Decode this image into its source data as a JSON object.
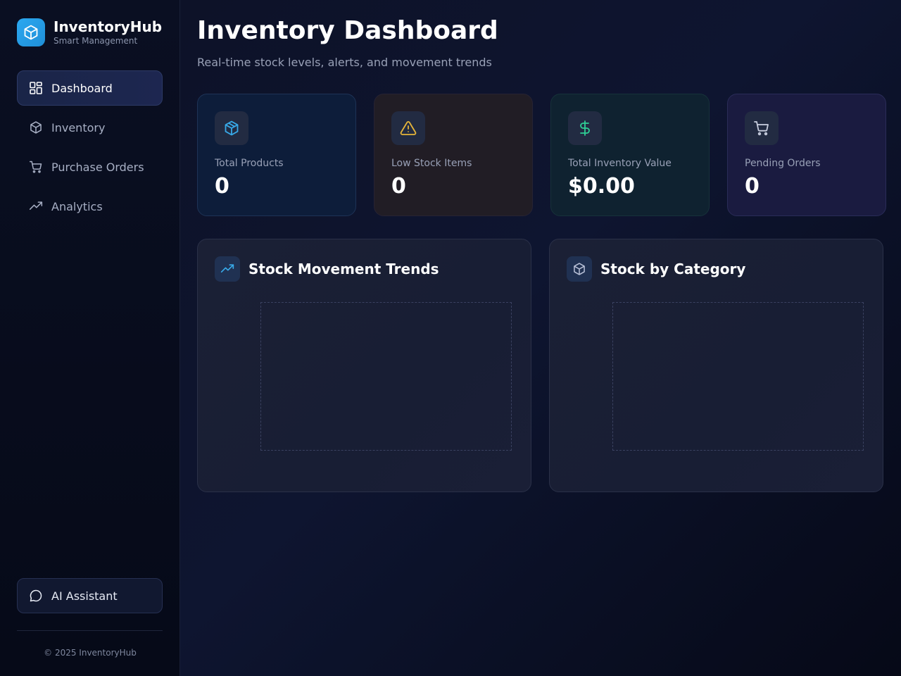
{
  "brand": {
    "name": "InventoryHub",
    "subtitle": "Smart Management",
    "logo_icon": "box-icon"
  },
  "nav": [
    {
      "label": "Dashboard",
      "icon": "grid-icon",
      "active": true
    },
    {
      "label": "Inventory",
      "icon": "box-icon",
      "active": false
    },
    {
      "label": "Purchase Orders",
      "icon": "cart-icon",
      "active": false
    },
    {
      "label": "Analytics",
      "icon": "trending-up-icon",
      "active": false
    }
  ],
  "assistant": {
    "label": "AI Assistant",
    "icon": "chat-bubble-icon"
  },
  "footer": "© 2025 InventoryHub",
  "header": {
    "title": "Inventory Dashboard",
    "subtitle": "Real-time stock levels, alerts, and movement trends"
  },
  "stats": [
    {
      "label": "Total Products",
      "value": "0",
      "icon": "box-icon",
      "color": "#38a9e8"
    },
    {
      "label": "Low Stock Items",
      "value": "0",
      "icon": "warning-triangle-icon",
      "color": "#e6b53a"
    },
    {
      "label": "Total Inventory Value",
      "value": "$0.00",
      "icon": "dollar-icon",
      "color": "#2fcf95"
    },
    {
      "label": "Pending Orders",
      "value": "0",
      "icon": "cart-icon",
      "color": "#c9cfe0"
    }
  ],
  "charts": [
    {
      "title": "Stock Movement Trends",
      "icon": "trending-up-icon",
      "color": "#38a9e8"
    },
    {
      "title": "Stock by Category",
      "icon": "box-icon",
      "color": "#b9c1d8"
    }
  ]
}
